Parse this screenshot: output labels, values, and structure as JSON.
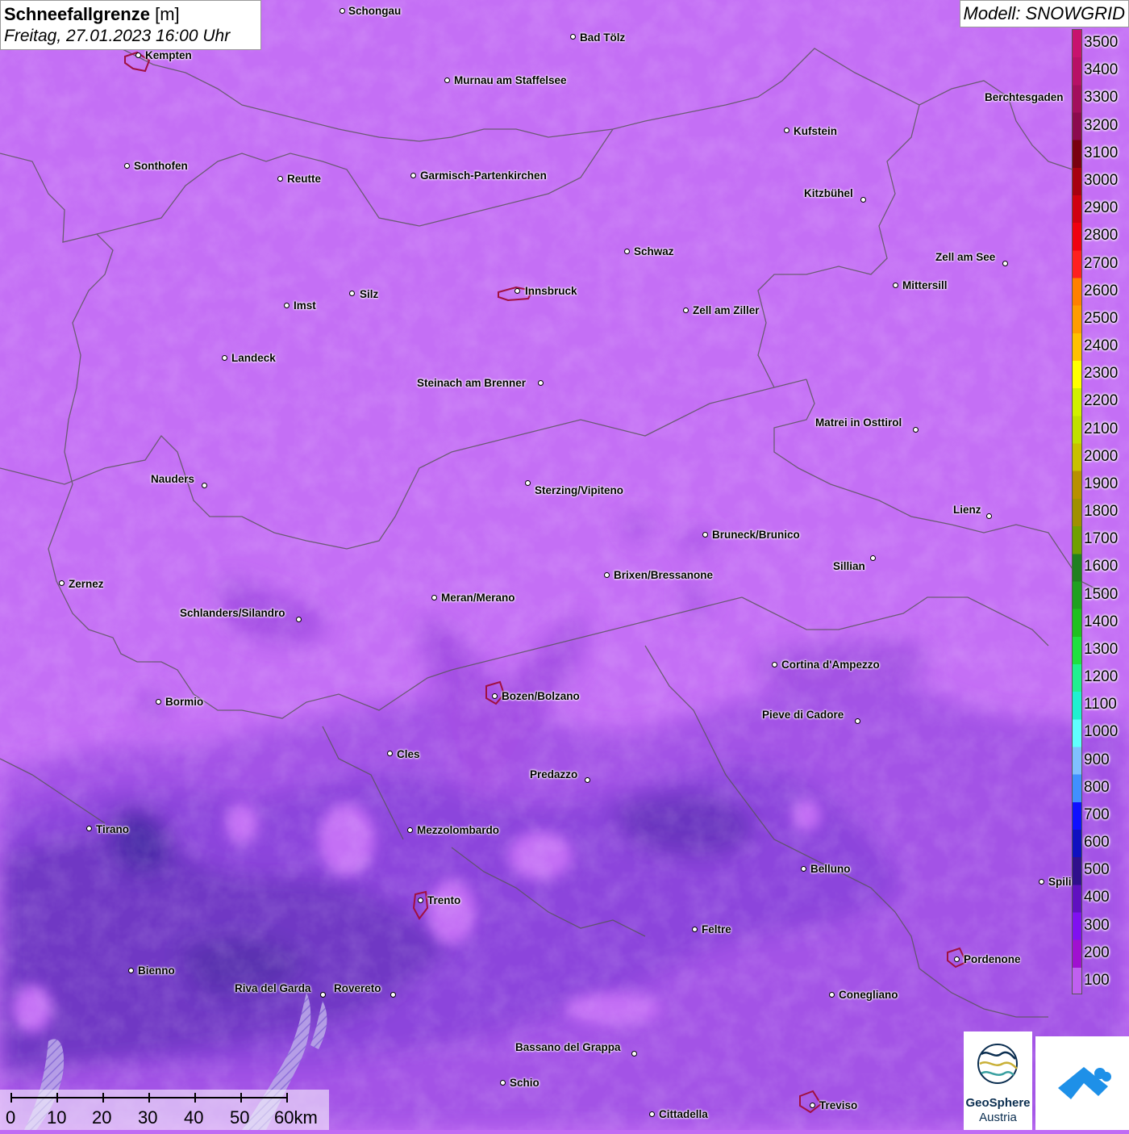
{
  "title": {
    "main": "Schneefallgrenze",
    "unit": "[m]",
    "datetime": "Freitag, 27.01.2023 16:00 Uhr"
  },
  "model": "Modell: SNOWGRID",
  "legend": {
    "labels": [
      "3500",
      "3400",
      "3300",
      "3200",
      "3100",
      "3000",
      "2900",
      "2800",
      "2700",
      "2600",
      "2500",
      "2400",
      "2300",
      "2200",
      "2100",
      "2000",
      "1900",
      "1800",
      "1700",
      "1600",
      "1500",
      "1400",
      "1300",
      "1200",
      "1100",
      "1000",
      "900",
      "800",
      "700",
      "600",
      "500",
      "400",
      "300",
      "200",
      "100"
    ],
    "colors": [
      "#c8126e",
      "#b81066",
      "#a30e5c",
      "#8c0a4e",
      "#7a0010",
      "#a80010",
      "#d00010",
      "#f00010",
      "#ff2020",
      "#ff8000",
      "#ff9c00",
      "#ffc000",
      "#ffff00",
      "#d0f000",
      "#c0e000",
      "#c8c000",
      "#b89000",
      "#a09000",
      "#70a000",
      "#208020",
      "#20a020",
      "#20c020",
      "#20e040",
      "#20f090",
      "#20f0d0",
      "#60ffff",
      "#80c0ff",
      "#4090ff",
      "#1010ff",
      "#1010c0",
      "#30108c",
      "#6010c0",
      "#8010f0",
      "#a010d0",
      "#c060f0"
    ]
  },
  "cities": [
    {
      "name": "Schongau"
    },
    {
      "name": "Bad Tölz"
    },
    {
      "name": "Kempten"
    },
    {
      "name": "Murnau am Staffelsee"
    },
    {
      "name": "Berchtesgaden"
    },
    {
      "name": "Kufstein"
    },
    {
      "name": "Sonthofen"
    },
    {
      "name": "Reutte"
    },
    {
      "name": "Garmisch-Partenkirchen"
    },
    {
      "name": "Kitzbühel"
    },
    {
      "name": "Schwaz"
    },
    {
      "name": "Zell am See"
    },
    {
      "name": "Innsbruck"
    },
    {
      "name": "Mittersill"
    },
    {
      "name": "Imst"
    },
    {
      "name": "Silz"
    },
    {
      "name": "Zell am Ziller"
    },
    {
      "name": "Landeck"
    },
    {
      "name": "Steinach am Brenner"
    },
    {
      "name": "Matrei in Osttirol"
    },
    {
      "name": "Nauders"
    },
    {
      "name": "Sterzing/Vipiteno"
    },
    {
      "name": "Lienz"
    },
    {
      "name": "Bruneck/Brunico"
    },
    {
      "name": "Sillian"
    },
    {
      "name": "Zernez"
    },
    {
      "name": "Brixen/Bressanone"
    },
    {
      "name": "Meran/Merano"
    },
    {
      "name": "Schlanders/Silandro"
    },
    {
      "name": "Cortina d'Ampezzo"
    },
    {
      "name": "Bozen/Bolzano"
    },
    {
      "name": "Bormio"
    },
    {
      "name": "Pieve di Cadore"
    },
    {
      "name": "Cles"
    },
    {
      "name": "Predazzo"
    },
    {
      "name": "Tirano"
    },
    {
      "name": "Mezzolombardo"
    },
    {
      "name": "Belluno"
    },
    {
      "name": "Spilimbergo"
    },
    {
      "name": "Trento"
    },
    {
      "name": "Feltre"
    },
    {
      "name": "Pordenone"
    },
    {
      "name": "Bienno"
    },
    {
      "name": "Riva del Garda"
    },
    {
      "name": "Rovereto"
    },
    {
      "name": "Conegliano"
    },
    {
      "name": "Bassano del Grappa"
    },
    {
      "name": "Schio"
    },
    {
      "name": "Treviso"
    },
    {
      "name": "Cittadella"
    }
  ],
  "scale": {
    "labels": [
      "0",
      "10",
      "20",
      "30",
      "40",
      "50",
      "60km"
    ]
  },
  "logo": {
    "name": "GeoSphere",
    "country": "Austria"
  }
}
